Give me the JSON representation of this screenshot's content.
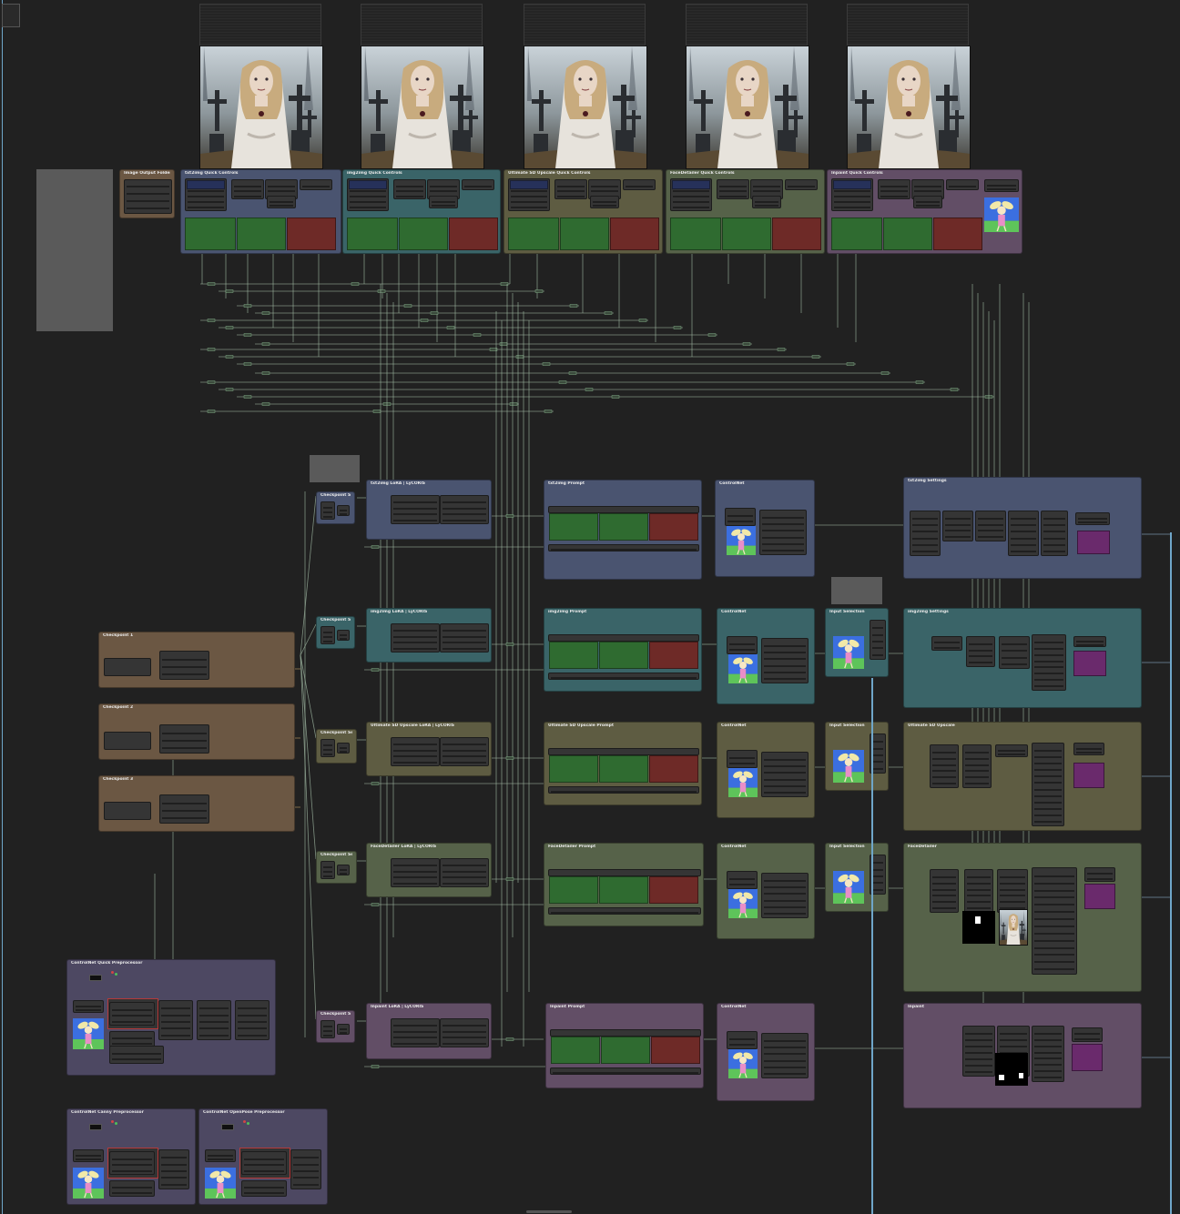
{
  "canvas": {
    "background": "#212121"
  },
  "colors": {
    "blue_group": "#4a5470",
    "cyan_group": "#3a6468",
    "olive_group": "#5e5c42",
    "green_group": "#566249",
    "purple_group": "#624e66",
    "brown_group": "#6b5743",
    "violet_group": "#4d4862",
    "positive_prompt": "#2f6b30",
    "negative_prompt": "#6e2a27",
    "mask_preview": "#6a2a6c",
    "link": "#9fb7a2"
  },
  "top_group_titles": [
    "Image Output Folder Name",
    "txt2img Quick Controls",
    "img2img Quick Controls",
    "Ultimate SD Upscale Quick Controls",
    "FaceDetailer Quick Controls",
    "Inpaint Quick Controls"
  ],
  "pipelines": [
    {
      "lora": "txt2img LoRA | LyCORIS",
      "prompt": "txt2img Prompt",
      "controlnet": "ControlNet",
      "settings": "txt2img Settings"
    },
    {
      "lora": "img2img LoRA | LyCORIS",
      "prompt": "img2img Prompt",
      "controlnet": "ControlNet",
      "input": "Input Selection",
      "settings": "img2img Settings"
    },
    {
      "lora": "Ultimate SD Upscale LoRA | LyCORIS",
      "prompt": "Ultimate SD Upscale Prompt",
      "controlnet": "ControlNet",
      "input": "Input Selection",
      "settings": "Ultimate SD Upscale"
    },
    {
      "lora": "FaceDetailer LoRA | LyCORIS",
      "prompt": "FaceDetailer Prompt",
      "controlnet": "ControlNet",
      "input": "Input Selection",
      "settings": "FaceDetailer"
    },
    {
      "lora": "Inpaint LoRA | LyCORIS",
      "prompt": "Inpaint Prompt",
      "controlnet": "ControlNet",
      "settings": "Inpaint"
    }
  ],
  "checkpoint_selection": "Checkpoint Selection",
  "checkpoints": [
    "Checkpoint 1",
    "Checkpoint 2",
    "Checkpoint 3"
  ],
  "preprocessors": [
    "ControlNet Quick Preprocessor",
    "ControlNet Canny Preprocessor",
    "ControlNet OpenPose Preprocessor"
  ],
  "icons": {
    "portrait_thumbnail": "portrait-icon",
    "pose_thumbnail": "stick-figure-icon",
    "mask_thumbnail": "mask-icon"
  }
}
